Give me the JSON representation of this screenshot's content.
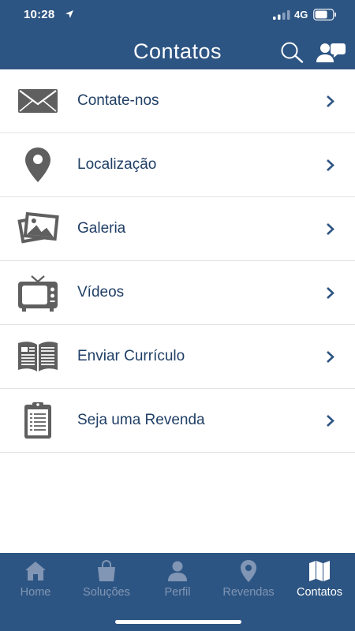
{
  "status_bar": {
    "time": "10:28",
    "network": "4G"
  },
  "header": {
    "title": "Contatos"
  },
  "list": {
    "items": [
      {
        "label": "Contate-nos",
        "icon": "envelope-icon"
      },
      {
        "label": "Localização",
        "icon": "map-pin-icon"
      },
      {
        "label": "Galeria",
        "icon": "gallery-icon"
      },
      {
        "label": "Vídeos",
        "icon": "tv-icon"
      },
      {
        "label": "Enviar Currículo",
        "icon": "open-book-icon"
      },
      {
        "label": "Seja uma Revenda",
        "icon": "clipboard-icon"
      }
    ]
  },
  "tabbar": {
    "tabs": [
      {
        "label": "Home",
        "icon": "house-icon",
        "active": false
      },
      {
        "label": "Soluções",
        "icon": "shopping-bag-icon",
        "active": false
      },
      {
        "label": "Perfil",
        "icon": "user-icon",
        "active": false
      },
      {
        "label": "Revendas",
        "icon": "map-pin-icon",
        "active": false
      },
      {
        "label": "Contatos",
        "icon": "map-icon",
        "active": true
      }
    ]
  },
  "colors": {
    "header_bg": "#2d5583",
    "label_text": "#203f66",
    "icon_gray": "#5f5f5f",
    "chevron": "#2d5583",
    "tab_inactive": "#8196b4",
    "tab_active": "#ffffff"
  }
}
